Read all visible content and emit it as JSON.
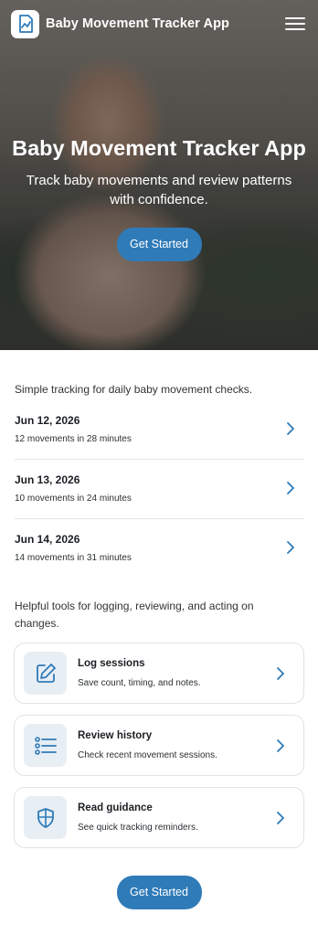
{
  "header": {
    "app_name": "Baby Movement Tracker App",
    "logo_icon": "chart-document-icon",
    "menu_icon": "hamburger-menu-icon"
  },
  "hero": {
    "title": "Baby Movement Tracker App",
    "subtitle": "Track baby movements and review patterns with confidence.",
    "cta_label": "Get Started"
  },
  "sessions": {
    "intro": "Simple tracking for daily baby movement checks.",
    "items": [
      {
        "date": "Jun 12, 2026",
        "detail": "12 movements in 28 minutes"
      },
      {
        "date": "Jun 13, 2026",
        "detail": "10 movements in 24 minutes"
      },
      {
        "date": "Jun 14, 2026",
        "detail": "14 movements in 31 minutes"
      }
    ]
  },
  "tools": {
    "intro": "Helpful tools for logging, reviewing, and acting on changes.",
    "items": [
      {
        "title": "Log sessions",
        "description": "Save count, timing, and notes.",
        "icon": "edit-icon"
      },
      {
        "title": "Review history",
        "description": "Check recent movement sessions.",
        "icon": "list-icon"
      },
      {
        "title": "Read guidance",
        "description": "See quick tracking reminders.",
        "icon": "shield-icon"
      }
    ]
  },
  "footer": {
    "cta_label": "Get Started"
  },
  "colors": {
    "accent": "#2f7bb8",
    "icon_bg": "#e7eef4",
    "border": "#dfe3e8"
  }
}
